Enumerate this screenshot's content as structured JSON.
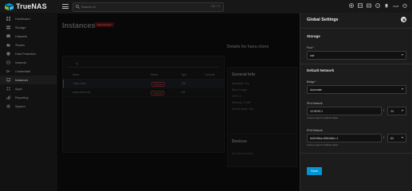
{
  "app": {
    "name": "TrueNAS"
  },
  "topbar": {
    "search_placeholder": "Search UI",
    "search_shortcut": "Ctrl + K",
    "user_label": "root"
  },
  "sidebar": {
    "items": [
      {
        "label": "Dashboard",
        "icon": "dashboard-icon"
      },
      {
        "label": "Storage",
        "icon": "storage-icon"
      },
      {
        "label": "Datasets",
        "icon": "datasets-icon"
      },
      {
        "label": "Shares",
        "icon": "shares-icon"
      },
      {
        "label": "Data Protection",
        "icon": "data-protection-icon"
      },
      {
        "label": "Network",
        "icon": "network-icon"
      },
      {
        "label": "Credentials",
        "icon": "credentials-icon"
      },
      {
        "label": "Instances",
        "icon": "instances-icon",
        "active": true
      },
      {
        "label": "Apps",
        "icon": "apps-icon"
      },
      {
        "label": "Reporting",
        "icon": "reporting-icon"
      },
      {
        "label": "System",
        "icon": "system-icon"
      }
    ]
  },
  "main": {
    "title": "Instances",
    "badge": "Experimental",
    "list": {
      "columns": [
        "Name",
        "Status",
        "Type",
        "Controls"
      ],
      "rows": [
        {
          "name": "haos-clone",
          "status": "Stopped",
          "type": "VM"
        },
        {
          "name": "haos-clone-ha1",
          "status": "Stopped",
          "type": "VM"
        }
      ]
    },
    "details": {
      "title": "Details for haos-clone",
      "general_info_title": "General Info",
      "info_lines": [
        "Autostart: Yes",
        "Base Image:",
        "CPU: 2",
        "Memory: 2 GiB",
        "Secure Boot: Yes"
      ],
      "devices_title": "Devices",
      "devices_text": "No devices added."
    }
  },
  "panel": {
    "title": "Global Settings",
    "storage_section": "Storage",
    "pool_label": "Pool *",
    "pool_value": "ssd",
    "network_section": "Default Network",
    "bridge_label": "Bridge *",
    "bridge_value": "Automatic",
    "ipv4_label": "IPv4 Network",
    "ipv4_value": "10.99.99.1",
    "ipv4_mask": "24",
    "ipv4_hint": "Leave empty for default values",
    "ipv6_label": "IPv6 Network",
    "ipv6_value": "fd42:b5ba:c59d:b8ec::1",
    "ipv6_mask": "64",
    "ipv6_hint": "Leave empty for default values",
    "save_label": "Save"
  },
  "colors": {
    "accent": "#0095d5",
    "panel_bg": "#1c1c1c",
    "badge_bg": "#5a1010"
  }
}
